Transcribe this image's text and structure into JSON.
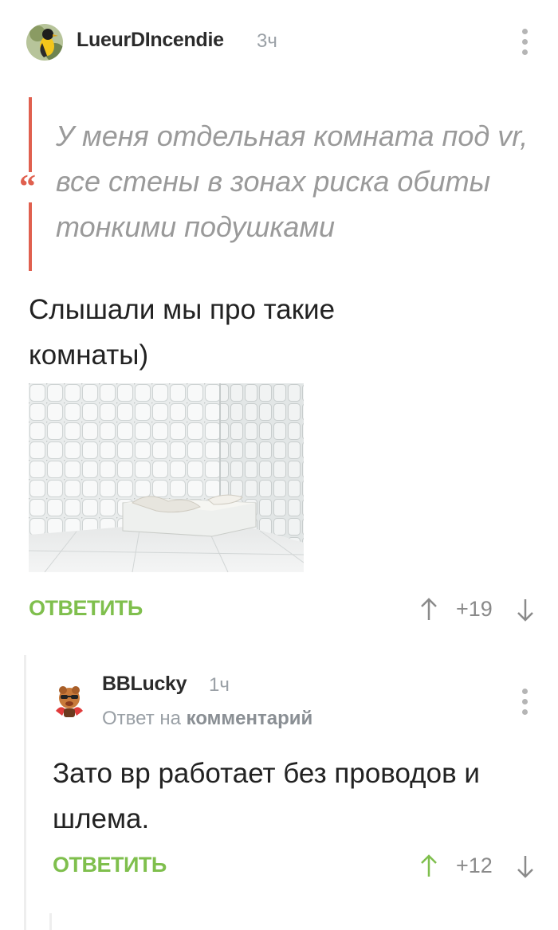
{
  "comment1": {
    "username": "LueurDIncendie",
    "time": "3ч",
    "quote": "У меня отдельная комната под vr, все стены в зонах риска обиты тонкими подушками",
    "text": "Слышали мы про такие комнаты)",
    "image_description": "padded-room-photo",
    "reply_label": "ОТВЕТИТЬ",
    "rating": "+19"
  },
  "comment2": {
    "username": "BBLucky",
    "time": "1ч",
    "reply_prefix": "Ответ на",
    "reply_target": "комментарий",
    "text": "Зато вр работает без проводов и шлема.",
    "reply_label": "ОТВЕТИТЬ",
    "rating": "+12"
  },
  "colors": {
    "accent_green": "#7fbf4d",
    "quote_red": "#e0604f",
    "vote_up_active": "#7fbf4d",
    "vote_neutral": "#8a8a8a"
  },
  "icons": [
    "more-icon",
    "quote-icon",
    "arrow-up-icon",
    "arrow-down-icon"
  ]
}
